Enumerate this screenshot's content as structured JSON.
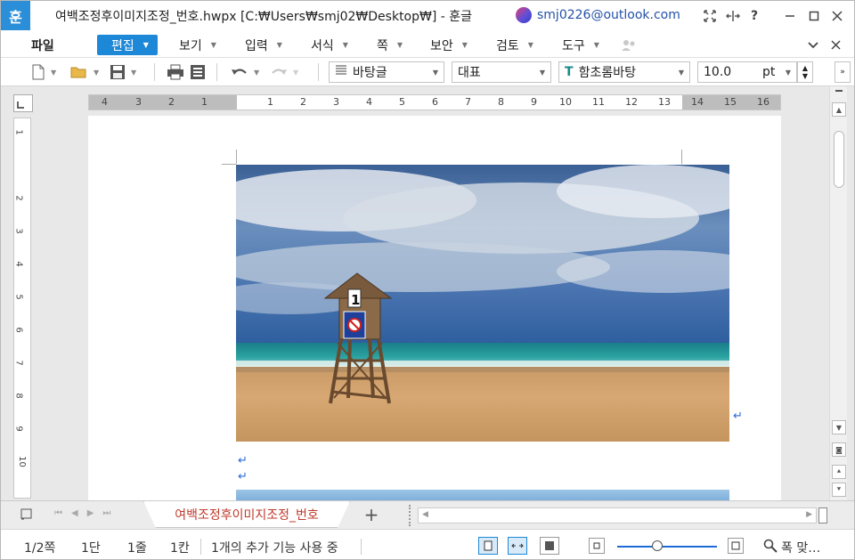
{
  "window": {
    "app_logo": "훈",
    "title": "여백조정후이미지조정_번호.hwpx [C:₩Users₩smj02₩Desktop₩] - 훈글",
    "account_email": "smj0226@outlook.com",
    "controls": [
      "expand-icon",
      "split-icon",
      "help-icon",
      "minimize-icon",
      "maximize-icon",
      "close-icon"
    ]
  },
  "menu": {
    "file": "파일",
    "items": [
      "편집",
      "보기",
      "입력",
      "서식",
      "쪽",
      "보안",
      "검토",
      "도구"
    ],
    "active_index": 0
  },
  "toolbar": {
    "style_combo": "바탕글",
    "lang_combo": "대표",
    "font_combo": "함초롬바탕",
    "font_size": "10.0",
    "size_unit": "pt"
  },
  "ruler": {
    "h_ticks_left": [
      "4",
      "3",
      "2",
      "1"
    ],
    "h_ticks": [
      "1",
      "2",
      "3",
      "4",
      "5",
      "6",
      "7",
      "8",
      "9",
      "10",
      "11",
      "12",
      "13",
      "14",
      "15",
      "16"
    ],
    "v_ticks": [
      "1",
      "2",
      "3",
      "4",
      "5",
      "6",
      "7",
      "8",
      "9",
      "10"
    ]
  },
  "document": {
    "tab_name": "여백조정후이미지조정_번호",
    "add_tab": "+",
    "paragraph_mark": "↵",
    "image_alt_objects": [
      "lifeguard-tower",
      "number-sign-1",
      "no-swimming-sign",
      "ocean",
      "beach",
      "cloudy-sky"
    ],
    "sign_number": "1"
  },
  "status": {
    "page": "1/2쪽",
    "section": "1단",
    "line": "1줄",
    "column": "1칸",
    "addon": "1개의 추가 기능 사용 중",
    "zoom_label": "폭 맞…",
    "zoom_fraction": 0.4
  },
  "colors": {
    "accent": "#1e88d8",
    "tab_text": "#c0392b",
    "para_mark": "#2a6ad8"
  }
}
